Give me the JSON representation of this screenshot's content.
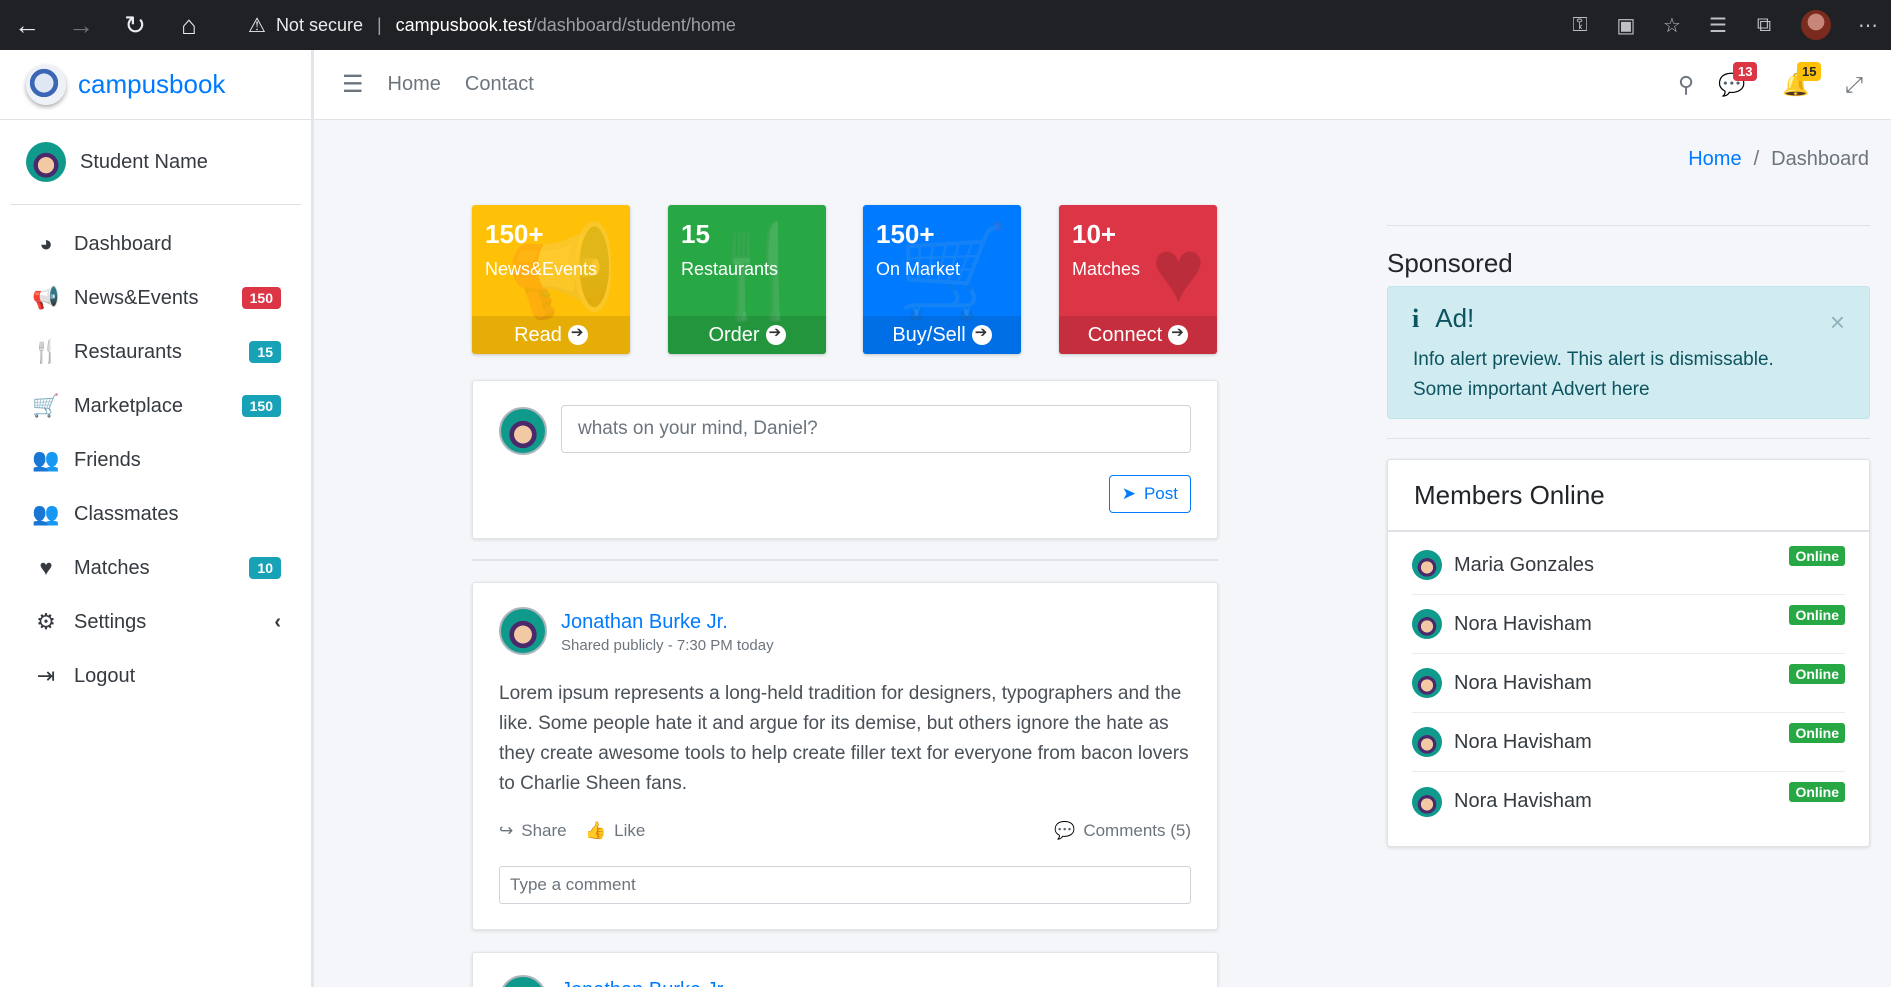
{
  "browser": {
    "security": "Not secure",
    "url_host": "campusbook.test",
    "url_path": "/dashboard/student/home"
  },
  "brand": {
    "name": "campusbook"
  },
  "user": {
    "name": "Student Name"
  },
  "sidebar": {
    "items": [
      {
        "label": "Dashboard",
        "icon": "dashboard-icon",
        "glyph": "◕"
      },
      {
        "label": "News&Events",
        "icon": "megaphone-icon",
        "glyph": "📢",
        "badge": "150",
        "badge_color": "#dc3545"
      },
      {
        "label": "Restaurants",
        "icon": "utensils-icon",
        "glyph": "🍴",
        "badge": "15",
        "badge_color": "#17a2b8"
      },
      {
        "label": "Marketplace",
        "icon": "cart-icon",
        "glyph": "🛒",
        "badge": "150",
        "badge_color": "#17a2b8"
      },
      {
        "label": "Friends",
        "icon": "users-icon",
        "glyph": "👥"
      },
      {
        "label": "Classmates",
        "icon": "user-friends-icon",
        "glyph": "👥"
      },
      {
        "label": "Matches",
        "icon": "heart-icon",
        "glyph": "♥",
        "badge": "10",
        "badge_color": "#17a2b8"
      },
      {
        "label": "Settings",
        "icon": "gear-icon",
        "glyph": "⚙",
        "chevron": "‹"
      },
      {
        "label": "Logout",
        "icon": "logout-icon",
        "glyph": "⇥"
      }
    ]
  },
  "topnav": {
    "links": [
      "Home",
      "Contact"
    ],
    "messages_count": "13",
    "notifications_count": "15"
  },
  "breadcrumb": {
    "home": "Home",
    "current": "Dashboard"
  },
  "boxes": [
    {
      "number": "150+",
      "caption": "News&Events",
      "link": "Read",
      "color": "#ffc107",
      "icon": "megaphone-icon",
      "glyph": "📢"
    },
    {
      "number": "15",
      "caption": "Restaurants",
      "link": "Order",
      "color": "#28a745",
      "icon": "utensils-icon",
      "glyph": "🍴"
    },
    {
      "number": "150+",
      "caption": "On Market",
      "link": "Buy/Sell",
      "color": "#007bff",
      "icon": "cart-icon",
      "glyph": "🛒"
    },
    {
      "number": "10+",
      "caption": "Matches",
      "link": "Connect",
      "color": "#dc3545",
      "icon": "heart-icon",
      "glyph": "♥"
    }
  ],
  "composer": {
    "placeholder": "whats on your mind, Daniel?",
    "post_label": "Post"
  },
  "post": {
    "author": "Jonathan Burke Jr.",
    "meta": "Shared publicly - 7:30 PM today",
    "body": "Lorem ipsum represents a long-held tradition for designers, typographers and the like. Some people hate it and argue for its demise, but others ignore the hate as they create awesome tools to help create filler text for everyone from bacon lovers to Charlie Sheen fans.",
    "share_label": "Share",
    "like_label": "Like",
    "comments_label": "Comments (5)",
    "comment_placeholder": "Type a comment"
  },
  "post2": {
    "author": "Jonathan Burke Jr."
  },
  "sponsored": {
    "heading": "Sponsored",
    "alert_title": "Ad!",
    "alert_line1": "Info alert preview. This alert is dismissable.",
    "alert_line2": "Some important Advert here"
  },
  "members": {
    "title": "Members Online",
    "status": "Online",
    "list": [
      "Maria Gonzales",
      "Nora Havisham",
      "Nora Havisham",
      "Nora Havisham",
      "Nora Havisham"
    ]
  }
}
